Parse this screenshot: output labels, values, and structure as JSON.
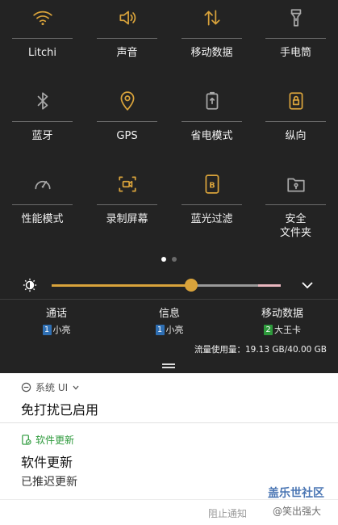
{
  "colors": {
    "panel_bg": "#232323",
    "accent": "#d9a33b",
    "inactive_icon": "#a8a8a8",
    "green": "#2e9a3c",
    "sim_blue": "#2f6fb3",
    "sim_green": "#2e9a3c"
  },
  "quick_settings": {
    "tiles": [
      {
        "label": "Litchi",
        "icon": "wifi-icon",
        "active": true
      },
      {
        "label": "声音",
        "icon": "volume-icon",
        "active": true
      },
      {
        "label": "移动数据",
        "icon": "mobile-data-icon",
        "active": true
      },
      {
        "label": "手电筒",
        "icon": "flashlight-icon",
        "active": false
      },
      {
        "label": "蓝牙",
        "icon": "bluetooth-icon",
        "active": false
      },
      {
        "label": "GPS",
        "icon": "location-icon",
        "active": true
      },
      {
        "label": "省电模式",
        "icon": "battery-saver-icon",
        "active": false
      },
      {
        "label": "纵向",
        "icon": "rotation-lock-icon",
        "active": true
      },
      {
        "label": "性能模式",
        "icon": "speedometer-icon",
        "active": false
      },
      {
        "label": "录制屏幕",
        "icon": "screen-record-icon",
        "active": true
      },
      {
        "label": "蓝光过滤",
        "icon": "blue-light-filter-icon",
        "active": true
      },
      {
        "label": "安全\n文件夹",
        "icon": "secure-folder-icon",
        "active": false
      }
    ],
    "page_count": 2,
    "current_page": 1
  },
  "brightness": {
    "level": 0.61,
    "icon": "brightness-icon"
  },
  "sims": [
    {
      "title": "通话",
      "badge": "1",
      "name": "小亮"
    },
    {
      "title": "信息",
      "badge": "1",
      "name": "小亮"
    },
    {
      "title": "移动数据",
      "badge": "2",
      "name": "大王卡"
    }
  ],
  "data_usage": "流量使用量：19.13 GB/40.00 GB",
  "notifications": {
    "system_ui": {
      "app_name": "系统 UI",
      "title": "免打扰已启用"
    },
    "software_update": {
      "app_name": "软件更新",
      "title": "软件更新",
      "subtitle": "已推迟更新"
    }
  },
  "bottom_bar": {
    "block_label": "阻止通知"
  },
  "watermark": {
    "line1": "盖乐世社区",
    "line2": "@笑出强大"
  }
}
